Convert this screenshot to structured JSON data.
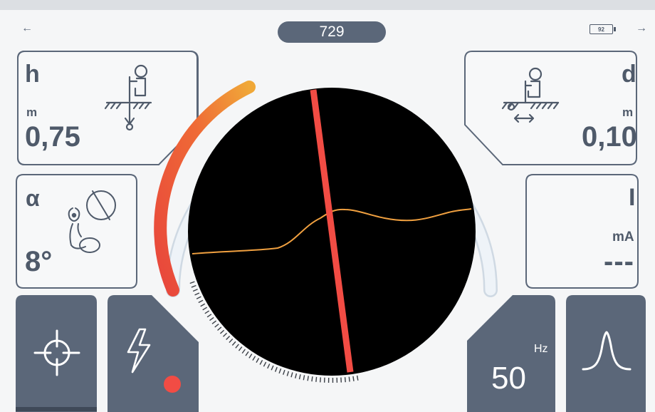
{
  "header": {
    "value": "729",
    "nav_back": "←",
    "nav_forward": "→",
    "battery": "92"
  },
  "depth_panel": {
    "symbol": "h",
    "unit": "m",
    "value": "0,75"
  },
  "offset_panel": {
    "symbol": "d",
    "unit": "m",
    "value": "0,10"
  },
  "angle_panel": {
    "symbol": "α",
    "value": "8°"
  },
  "current_panel": {
    "symbol": "I",
    "unit": "mA",
    "value": "---"
  },
  "frequency_button": {
    "unit": "Hz",
    "value": "50"
  },
  "signal_strength": {
    "level": 0.22,
    "colors": [
      "#e8463c",
      "#f0a030"
    ]
  },
  "accent_color": "#f24c44",
  "icons": {
    "depth": "person-probe-depth-icon",
    "offset": "person-probe-offset-icon",
    "angle": "sonde-tilt-icon",
    "locate": "crosshair-icon",
    "power": "lightning-icon",
    "peak": "peak-mode-icon"
  }
}
